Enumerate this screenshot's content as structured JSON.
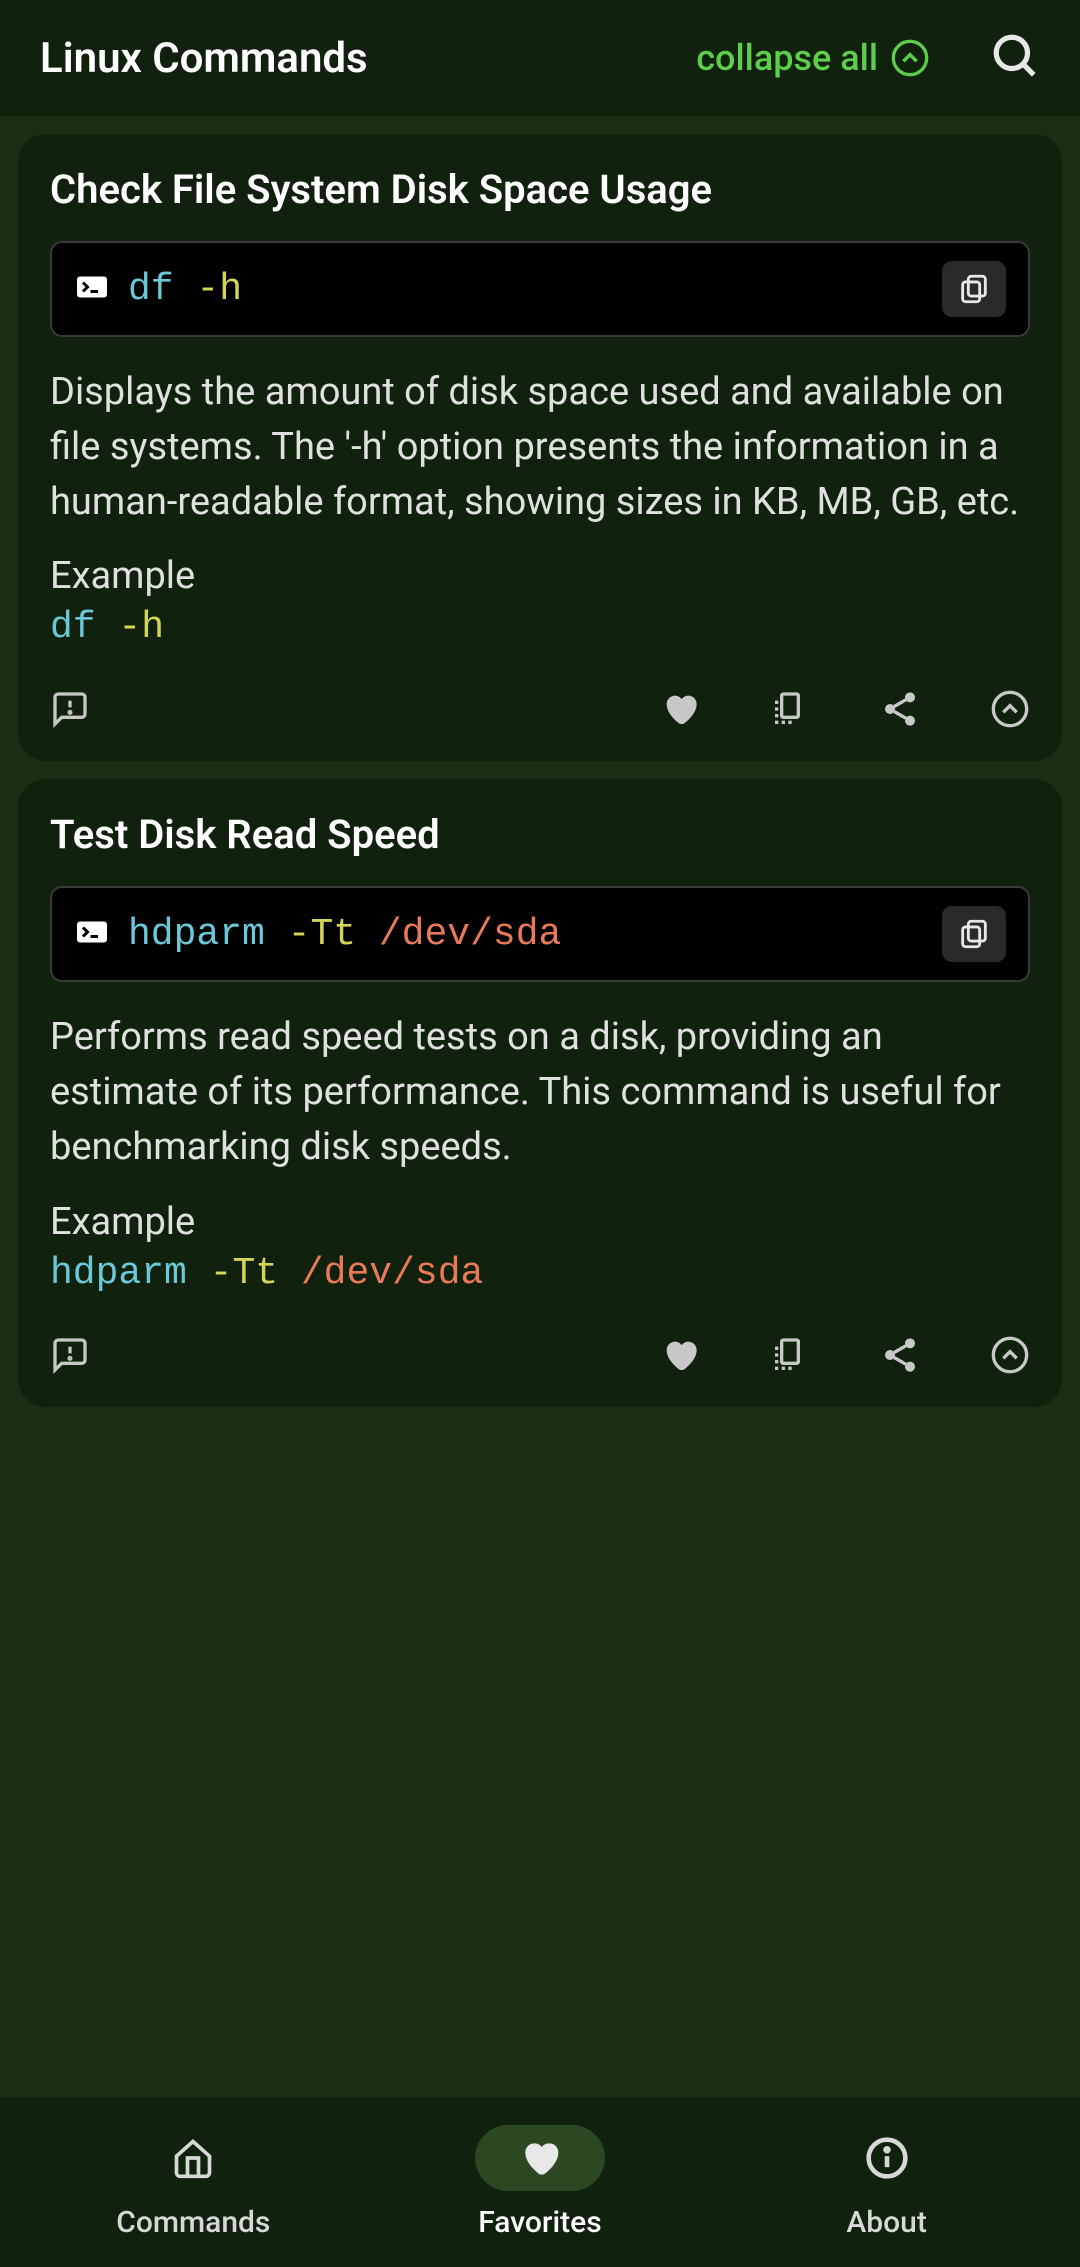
{
  "header": {
    "title": "Linux Commands",
    "collapse_label": "collapse all"
  },
  "cards": [
    {
      "title": "Check File System Disk Space Usage",
      "cmd": "df",
      "opt": "-h",
      "arg": "",
      "description": "Displays the amount of disk space used and available on file systems. The '-h' option presents the information in a human-readable format, showing sizes in KB, MB, GB, etc.",
      "example_label": "Example",
      "example_cmd": "df",
      "example_opt": "-h",
      "example_arg": ""
    },
    {
      "title": "Test Disk Read Speed",
      "cmd": "hdparm",
      "opt": "-Tt",
      "arg": "/dev/sda",
      "description": "Performs read speed tests on a disk, providing an estimate of its performance. This command is useful for benchmarking disk speeds.",
      "example_label": "Example",
      "example_cmd": "hdparm",
      "example_opt": "-Tt",
      "example_arg": "/dev/sda"
    }
  ],
  "nav": {
    "commands": "Commands",
    "favorites": "Favorites",
    "about": "About"
  }
}
